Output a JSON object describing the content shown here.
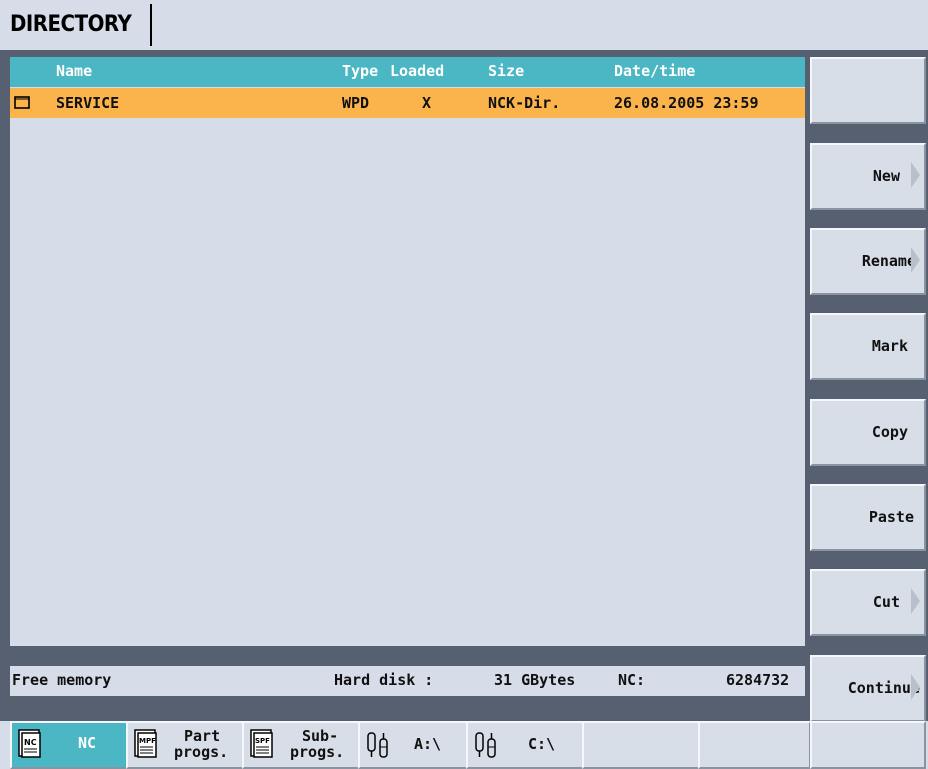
{
  "window": {
    "title": "DIRECTORY"
  },
  "table": {
    "headers": {
      "name": "Name",
      "type": "Type",
      "loaded": "Loaded",
      "size": "Size",
      "datetime": "Date/time"
    },
    "rows": [
      {
        "icon": "folder-icon",
        "name": "SERVICE",
        "type": "WPD",
        "loaded": "X",
        "size": "NCK-Dir.",
        "datetime": "26.08.2005 23:59",
        "selected": true
      }
    ]
  },
  "status": {
    "free_memory_label": "Free memory",
    "hard_disk_label": "Hard disk :",
    "hard_disk_value": "31 GBytes",
    "nc_label": "NC:",
    "nc_value": "6284732"
  },
  "vertical_softkeys": [
    {
      "label": "",
      "arrow": false
    },
    {
      "label": "New",
      "arrow": true
    },
    {
      "label": "Rename",
      "arrow": true
    },
    {
      "label": "Mark",
      "arrow": false
    },
    {
      "label": "Copy",
      "arrow": false
    },
    {
      "label": "Paste",
      "arrow": false
    },
    {
      "label": "Cut",
      "arrow": true
    },
    {
      "label": "Continue",
      "arrow": true
    }
  ],
  "horizontal_softkeys": [
    {
      "label": "NC",
      "icon": "nc-icon",
      "icon_text": "NC",
      "active": true
    },
    {
      "label_line1": "Part",
      "label_line2": "progs.",
      "icon": "mpf-icon",
      "icon_text": "MPF"
    },
    {
      "label_line1": "Sub-",
      "label_line2": "progs.",
      "icon": "spf-icon",
      "icon_text": "SPF"
    },
    {
      "label": "A:\\",
      "icon": "drive-icon"
    },
    {
      "label": "C:\\",
      "icon": "drive-icon"
    },
    {
      "label": ""
    },
    {
      "label": ""
    },
    {
      "label": ""
    }
  ],
  "colors": {
    "header_bg": "#4bb6c4",
    "selected_row_bg": "#fbb44c",
    "panel_bg": "#d6dde8",
    "band_bg": "#566070"
  }
}
